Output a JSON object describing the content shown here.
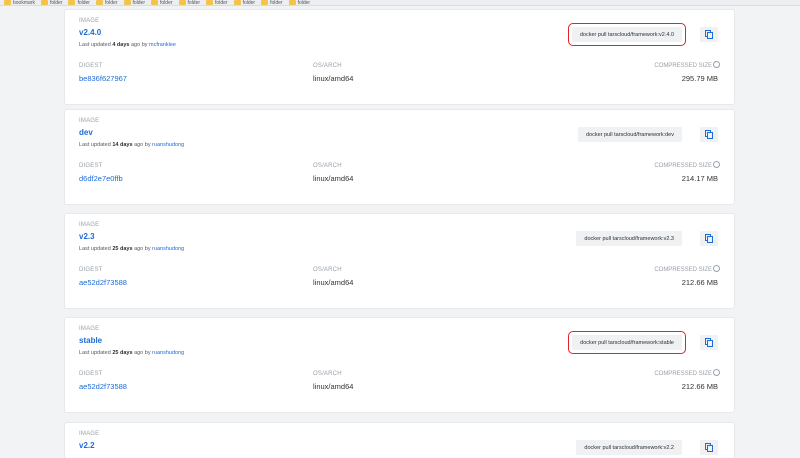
{
  "bookmarks": [
    {
      "label": "bookmark"
    },
    {
      "label": "folder"
    },
    {
      "label": "folder"
    },
    {
      "label": "folder"
    },
    {
      "label": "folder"
    },
    {
      "label": "folder"
    },
    {
      "label": "folder"
    },
    {
      "label": "folder"
    },
    {
      "label": "folder"
    },
    {
      "label": "folder"
    },
    {
      "label": "folder"
    }
  ],
  "labels": {
    "image": "IMAGE",
    "digest": "DIGEST",
    "osarch": "OS/ARCH",
    "compressed": "COMPRESSED SIZE",
    "last_updated": "Last updated",
    "ago": "ago by"
  },
  "cards": [
    {
      "tag": "v2.4.0",
      "age": "4 days",
      "user": "mcfranklee",
      "digest": "be836f627967",
      "osarch": "linux/amd64",
      "size": "295.79 MB",
      "pull": "docker pull tarscloud/framework:v2.4.0",
      "highlight": true
    },
    {
      "tag": "dev",
      "age": "14 days",
      "user": "ruanshudong",
      "digest": "d6df2e7e0ffb",
      "osarch": "linux/amd64",
      "size": "214.17 MB",
      "pull": "docker pull tarscloud/framework:dev",
      "highlight": false
    },
    {
      "tag": "v2.3",
      "age": "25 days",
      "user": "ruanshudong",
      "digest": "ae52d2f73588",
      "osarch": "linux/amd64",
      "size": "212.66 MB",
      "pull": "docker pull tarscloud/framework:v2.3",
      "highlight": false
    },
    {
      "tag": "stable",
      "age": "25 days",
      "user": "ruanshudong",
      "digest": "ae52d2f73588",
      "osarch": "linux/amd64",
      "size": "212.66 MB",
      "pull": "docker pull tarscloud/framework:stable",
      "highlight": true
    },
    {
      "tag": "v2.2",
      "pull": "docker pull tarscloud/framework:v2.2",
      "partial": true
    }
  ],
  "colors": {
    "link": "#1d6bd6",
    "highlight": "#e0242b",
    "background": "#f2f3f5"
  },
  "icons": {
    "copy": "copy-icon",
    "info": "info-icon",
    "folder": "folder-icon"
  }
}
